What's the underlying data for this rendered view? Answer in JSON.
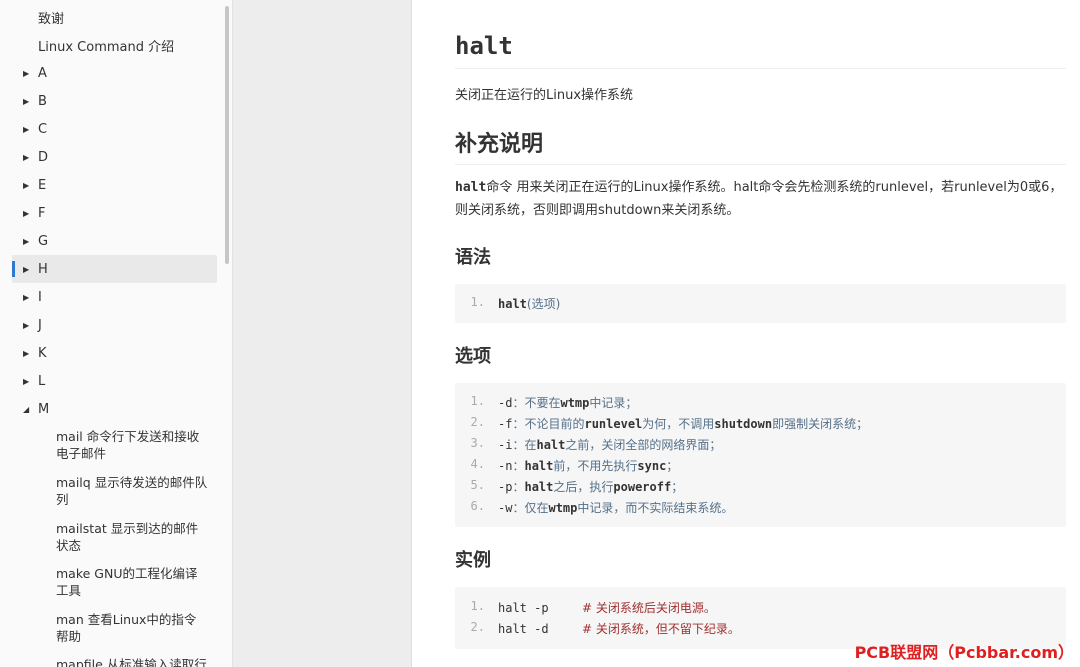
{
  "sidebar": {
    "items": [
      {
        "label": "致谢",
        "expander": ""
      },
      {
        "label": "Linux Command 介绍",
        "expander": ""
      },
      {
        "label": "A",
        "expander": "▶"
      },
      {
        "label": "B",
        "expander": "▶"
      },
      {
        "label": "C",
        "expander": "▶"
      },
      {
        "label": "D",
        "expander": "▶"
      },
      {
        "label": "E",
        "expander": "▶"
      },
      {
        "label": "F",
        "expander": "▶"
      },
      {
        "label": "G",
        "expander": "▶"
      },
      {
        "label": "H",
        "expander": "▶"
      },
      {
        "label": "I",
        "expander": "▶"
      },
      {
        "label": "J",
        "expander": "▶"
      },
      {
        "label": "K",
        "expander": "▶"
      },
      {
        "label": "L",
        "expander": "▶"
      },
      {
        "label": "M",
        "expander": "◢"
      }
    ],
    "sub_items": [
      "mail 命令行下发送和接收电子邮件",
      "mailq 显示待发送的邮件队列",
      "mailstat 显示到达的邮件状态",
      "make GNU的工程化编译工具",
      "man 查看Linux中的指令帮助",
      "mapfile 从标准输入读取行"
    ]
  },
  "article": {
    "title": "halt",
    "description": "关闭正在运行的Linux操作系统",
    "section_more": "补充说明",
    "para_cmd": "halt",
    "para_text": "命令 用来关闭正在运行的Linux操作系统。halt命令会先检测系统的runlevel，若runlevel为0或6，则关闭系统，否则即调用shutdown来关闭系统。",
    "section_syntax": "语法",
    "syntax": {
      "ln": "1.",
      "cmd": "halt",
      "rest": "(选项)"
    },
    "section_options": "选项",
    "options": [
      {
        "ln": "1.",
        "flag": "-d",
        "pre": "：不要在",
        "key": "wtmp",
        "post": "中记录；",
        "key2": "",
        "post2": ""
      },
      {
        "ln": "2.",
        "flag": "-f",
        "pre": "：不论目前的",
        "key": "runlevel",
        "post": "为何，不调用",
        "key2": "shutdown",
        "post2": "即强制关闭系统；"
      },
      {
        "ln": "3.",
        "flag": "-i",
        "pre": "：在",
        "key": "halt",
        "post": "之前，关闭全部的网络界面；",
        "key2": "",
        "post2": ""
      },
      {
        "ln": "4.",
        "flag": "-n",
        "pre": "：",
        "key": "halt",
        "post": "前，不用先执行",
        "key2": "sync",
        "post2": "；"
      },
      {
        "ln": "5.",
        "flag": "-p",
        "pre": "：",
        "key": "halt",
        "post": "之后，执行",
        "key2": "poweroff",
        "post2": "；"
      },
      {
        "ln": "6.",
        "flag": "-w",
        "pre": "：仅在",
        "key": "wtmp",
        "post": "中记录，而不实际结束系统。",
        "key2": "",
        "post2": ""
      }
    ],
    "section_examples": "实例",
    "examples": [
      {
        "ln": "1.",
        "cmd": "halt",
        "arg": " -p",
        "comment": "# 关闭系统后关闭电源。"
      },
      {
        "ln": "2.",
        "cmd": "halt",
        "arg": " -d",
        "comment": "# 关闭系统，但不留下纪录。"
      }
    ]
  },
  "watermark": "PCB联盟网（Pcbbar.com）",
  "colors": {
    "accent": "#2b7ad0",
    "comment": "#a03030",
    "watermark": "#e02020"
  }
}
